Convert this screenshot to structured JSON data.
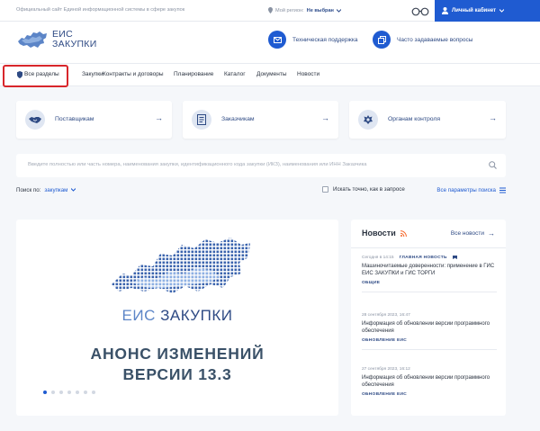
{
  "topbar": {
    "official_text": "Официальный сайт Единой информационной системы в сфере закупок",
    "region_label": "Мой регион:",
    "region_value": "Не выбран",
    "cabinet_label": "Личный кабинет"
  },
  "header": {
    "logo_line1": "ЕИС",
    "logo_line2": "ЗАКУПКИ",
    "support_label": "Техническая поддержка",
    "faq_label": "Часто задаваемые вопросы"
  },
  "nav": {
    "items": [
      "Все разделы",
      "Закупки",
      "Контракты и договоры",
      "Планирование",
      "Каталог",
      "Документы",
      "Новости"
    ]
  },
  "cards": [
    {
      "label": "Поставщикам",
      "icon": "handshake-icon"
    },
    {
      "label": "Заказчикам",
      "icon": "document-icon"
    },
    {
      "label": "Органам контроля",
      "icon": "emblem-icon"
    }
  ],
  "search": {
    "placeholder": "Введите полностью или часть номера, наименования закупки, идентификационного кода закупки (ИКЗ), наименования или ИНН Заказчика",
    "search_by_label": "Поиск по:",
    "search_by_value": "закупкам",
    "exact_label": "Искать точно, как в запросе",
    "advanced_label": "Все параметры поиска"
  },
  "banner": {
    "title_part1": "ЕИС",
    "title_part2": "ЗАКУПКИ",
    "announce": "АНОНС ИЗМЕНЕНИЙ",
    "version": "ВЕРСИИ 13.3",
    "slide_count": 7,
    "active_slide": 1
  },
  "news": {
    "heading": "Новости",
    "all_label": "Все новости",
    "items": [
      {
        "date": "Сегодня в 14:15",
        "badge": "ГЛАВНАЯ НОВОСТЬ",
        "title": "Машиночитаемые доверенности: применение в ГИС ЕИС ЗАКУПКИ и ГИС ТОРГИ",
        "tag": "ОБЩИЕ"
      },
      {
        "date": "28 сентября 2023, 16:47",
        "badge": "",
        "title": "Информация об обновлении версии программного обеспечения",
        "tag": "ОБНОВЛЕНИЕ ЕИС"
      },
      {
        "date": "27 сентября 2023, 16:12",
        "badge": "",
        "title": "Информация об обновлении версии программного обеспечения",
        "tag": "ОБНОВЛЕНИЕ ЕИС"
      }
    ]
  },
  "colors": {
    "accent": "#1f5bd1",
    "brand_text": "#2e4a84",
    "highlight": "#d8262b",
    "rss": "#f5672a"
  }
}
